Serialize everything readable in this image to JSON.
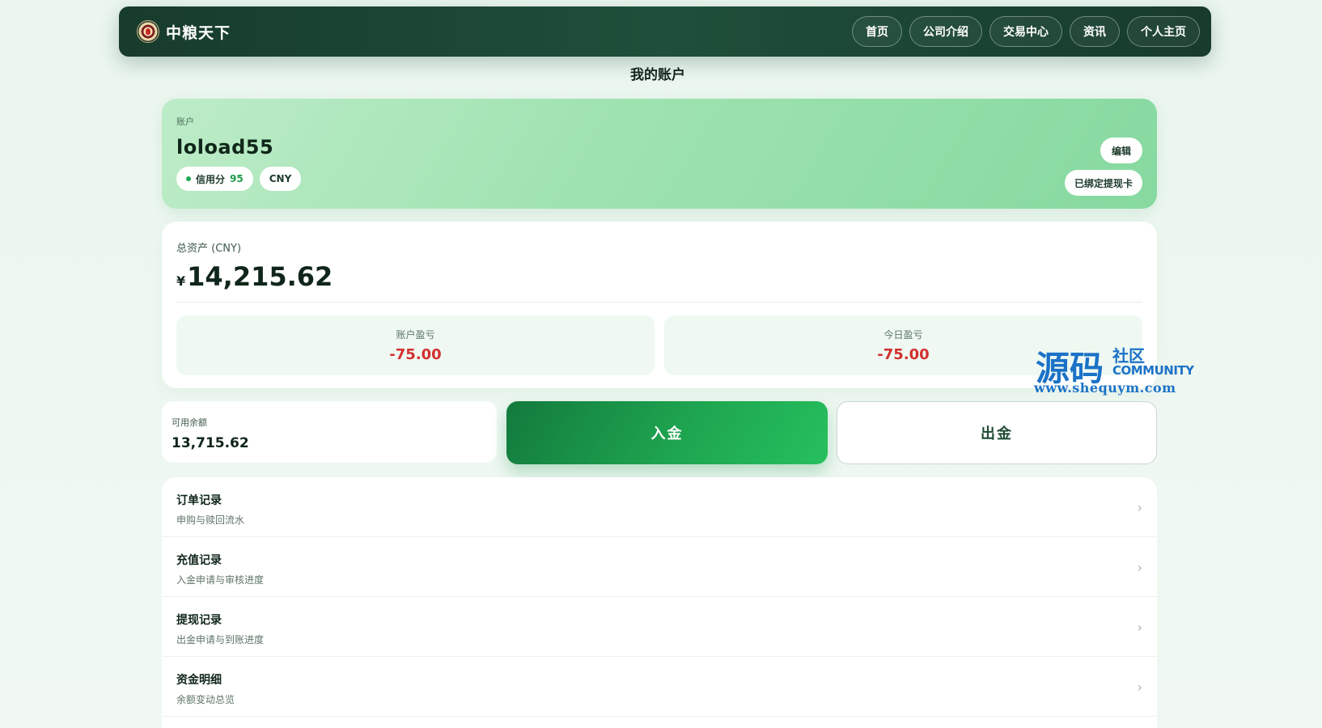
{
  "header": {
    "brand": "中粮天下",
    "nav": [
      "首页",
      "公司介绍",
      "交易中心",
      "资讯",
      "个人主页"
    ]
  },
  "page": {
    "title": "我的账户"
  },
  "account": {
    "label": "账户",
    "username": "loload55",
    "credit_label": "信用分",
    "credit_score": "95",
    "currency": "CNY",
    "edit_label": "编辑",
    "bound_card_label": "已绑定提现卡"
  },
  "assets": {
    "label": "总资产 (CNY)",
    "currency_sign": "¥",
    "total": "14,215.62",
    "account_pnl_label": "账户盈亏",
    "account_pnl": "-75.00",
    "today_pnl_label": "今日盈亏",
    "today_pnl": "-75.00"
  },
  "balance": {
    "label": "可用余额",
    "value": "13,715.62"
  },
  "actions": {
    "deposit": "入金",
    "withdraw": "出金"
  },
  "menu": [
    {
      "title": "订单记录",
      "subtitle": "申购与赎回流水"
    },
    {
      "title": "充值记录",
      "subtitle": "入金申请与审核进度"
    },
    {
      "title": "提现记录",
      "subtitle": "出金申请与到账进度"
    },
    {
      "title": "资金明细",
      "subtitle": "余额变动总览"
    }
  ],
  "watermark": {
    "main": "源码",
    "side": "社区",
    "community": "COMMUNITY",
    "url": "www.shequym.com"
  },
  "colors": {
    "nav_bg": "#1f4f3a",
    "accent_green": "#1ea550",
    "loss_red": "#d32f2f",
    "watermark_blue": "#1b72c7"
  },
  "icons": {
    "menu_chevron": "chevron-right-icon",
    "brand_logo": "brand-logo-icon"
  }
}
